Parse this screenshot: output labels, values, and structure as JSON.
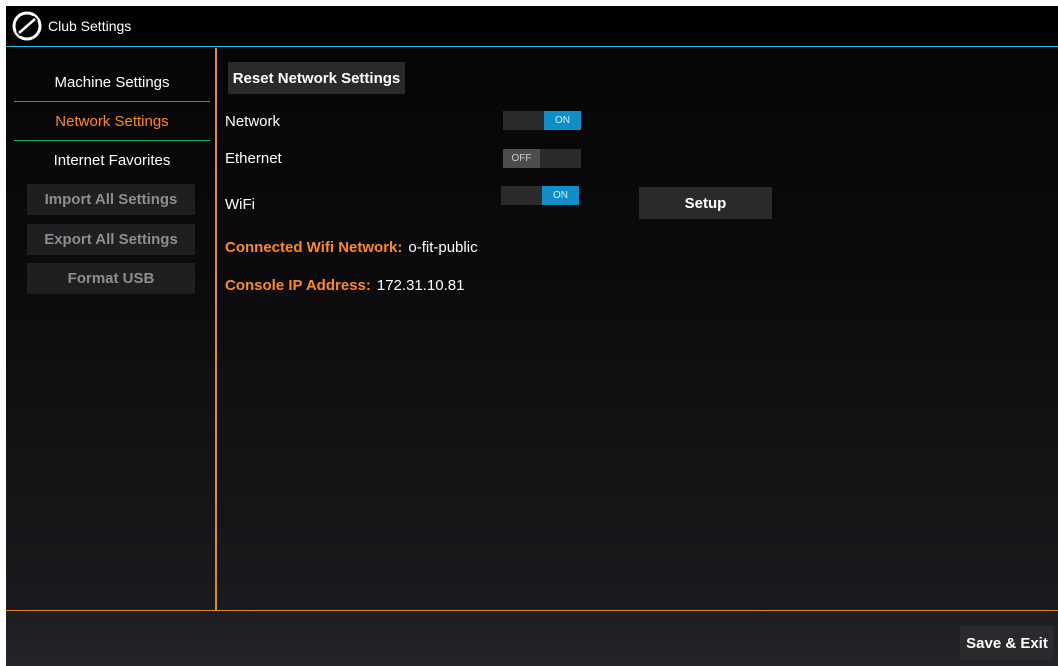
{
  "header": {
    "title": "Club Settings",
    "logo_icon": "brand-logo-icon"
  },
  "sidebar": {
    "items": [
      {
        "label": "Machine Settings",
        "active": false
      },
      {
        "label": "Network Settings",
        "active": true
      },
      {
        "label": "Internet Favorites",
        "active": false
      }
    ],
    "buttons": [
      {
        "label": "Import All Settings",
        "enabled": false
      },
      {
        "label": "Export All Settings",
        "enabled": false
      },
      {
        "label": "Format USB",
        "enabled": false
      }
    ]
  },
  "main": {
    "reset_label": "Reset Network Settings",
    "rows": [
      {
        "label": "Network",
        "toggle": "ON"
      },
      {
        "label": "Ethernet",
        "toggle": "OFF"
      },
      {
        "label": "WiFi",
        "toggle": "ON"
      }
    ],
    "setup_label": "Setup",
    "connected_wifi": {
      "label": "Connected Wifi Network:",
      "value": "o-fit-public"
    },
    "console_ip": {
      "label": "Console IP Address:",
      "value": "172.31.10.81"
    }
  },
  "footer": {
    "save_exit_label": "Save & Exit"
  },
  "colors": {
    "accent_orange": "#ff8a22",
    "header_line": "#33b5e5",
    "toggle_on": "#0f8ec7",
    "divider_green": "#1aa876"
  }
}
